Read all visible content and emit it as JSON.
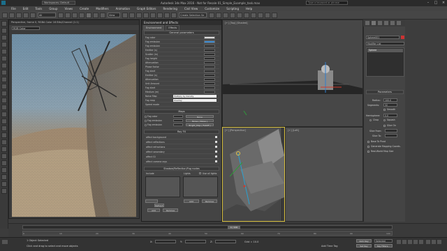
{
  "titlebar": {
    "workspace": "Workspaces: Default",
    "title": "Autodesk 3ds Max 2016 - Not for Resale   01_Simple_Example_task.max",
    "search_placeholder": "Type a keyword or phrase"
  },
  "menubar": {
    "items": [
      "File",
      "Edit",
      "Tools",
      "Group",
      "Views",
      "Create",
      "Modifiers",
      "Animation",
      "Graph Editors",
      "Rendering",
      "Civil View",
      "Customize",
      "Scripting",
      "Help"
    ]
  },
  "toolbar": {
    "filter_dropdown": "All",
    "view_dropdown": "View",
    "selection_set": "Create Selection Se"
  },
  "render_window": {
    "title": "Perspective, frame 0, RGBA Color 16 Bits/Channel (1:1)",
    "channel_dropdown": "RGB Color"
  },
  "env_dialog": {
    "title": "Environment and Effects",
    "tabs": [
      "Environment",
      "Effects"
    ],
    "general_header": "General parameters",
    "general_params": [
      "Fog color",
      "Fog emission",
      "Fog emission",
      "Emitter (s)",
      "Scatter (m)",
      "Fog height",
      "Attenuation",
      "Phase factor",
      "Fog start",
      "Emitter (s)",
      "Attenuation",
      "Unit Amount",
      "Fog start",
      "Medium (m)",
      "Fog radius",
      "Fog color"
    ],
    "noise_map_label": "Noise Map",
    "noise_map_value": "Multiply by density",
    "fog_map_label": "Fog map",
    "fog_map_value": "Overlay",
    "quality_label": "Speed mode",
    "maps_header": "Maps",
    "maps": [
      {
        "label": "Fog color",
        "btn": "None"
      },
      {
        "label": "Fog emission",
        "btn": "Noise ( Noise )"
      },
      {
        "label": "Fog emission",
        "btn": "Bright_Map ( Falloff )"
      }
    ],
    "fx_header": "Ray FX",
    "fx_rows": [
      "affect background",
      "affect reflections",
      "affect refractions",
      "affect secondary",
      "affect GI",
      "affect camera rays"
    ],
    "lists_header": "Shadow/Reflection/Fog nodes",
    "list_left": "Include",
    "list_right": "Lights",
    "use_all_lights": "Use all lights",
    "add_label": "Add",
    "remove_label": "Remove",
    "add_label_2": "Add",
    "remove_label_2": "Remove",
    "refresh_label": "Refresh"
  },
  "viewports": {
    "top_right_label": "[+] [Top] [Shaded]",
    "bottom_left_label": "[+] [Perspective]",
    "bottom_right_label": "[+] [Left]"
  },
  "command_panel": {
    "object_name": "Sphere001",
    "modifier_list": "Modifier List",
    "stack_item": "Sphere",
    "params_header": "Parameters",
    "radius_label": "Radius:",
    "radius_value": "100.0",
    "segments_label": "Segments:",
    "segments_value": "32",
    "smooth_label": "Smooth",
    "hemisphere_label": "Hemisphere:",
    "hemisphere_value": "0.0",
    "chop_label": "Chop",
    "squash_label": "Squash",
    "slice_on_label": "Slice On",
    "slice_from_label": "Slice From:",
    "slice_to_label": "Slice To:",
    "base_to_pivot_label": "Base To Pivot",
    "gen_mapping_label": "Generate Mapping Coords.",
    "real_world_label": "Real-World Map Size"
  },
  "timeline": {
    "frame_readout": "0 / 100",
    "ticks": [
      "0",
      "10",
      "20",
      "30",
      "40",
      "50",
      "60",
      "70",
      "80",
      "90",
      "100"
    ]
  },
  "statusbar": {
    "selection": "1 Object Selected",
    "prompt": "Click and drag to select and move objects",
    "x_label": "X:",
    "y_label": "Y:",
    "z_label": "Z:",
    "grid": "Grid = 10.0",
    "autokey": "Auto Key",
    "setkey": "Set Key",
    "selected": "Selected",
    "time_tag": "Add Time Tag",
    "key_filters": "Key Filters..."
  },
  "colors": {
    "accent_selection": "#e0c24a",
    "viewport_bg": "#4a4a4a",
    "dialog_bg": "#444444"
  }
}
